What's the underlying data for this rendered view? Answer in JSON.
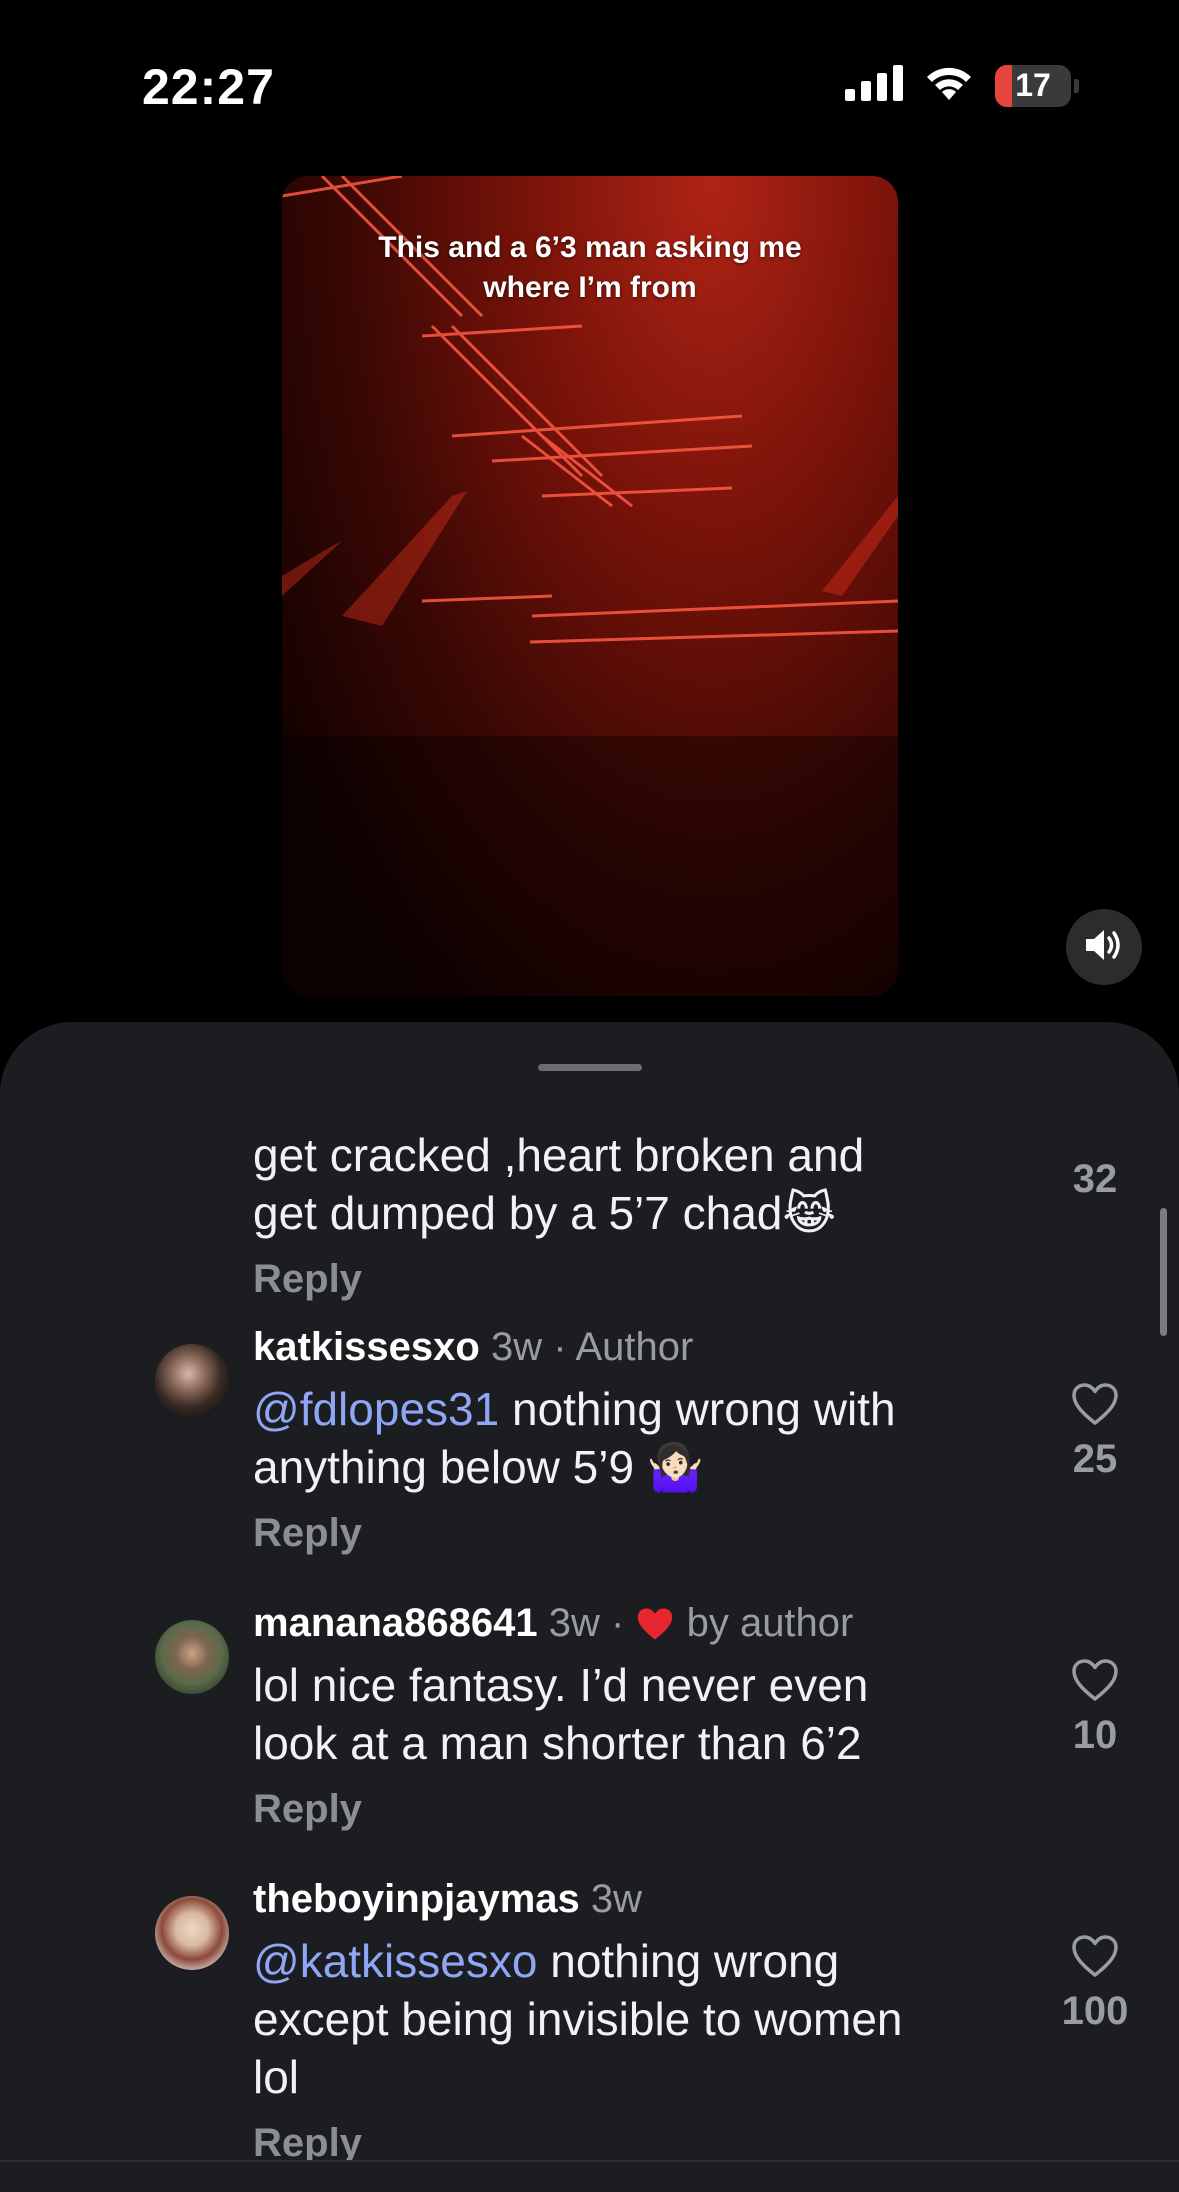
{
  "status_bar": {
    "time": "22:27",
    "battery_level": "17",
    "icons": [
      "signal-icon",
      "wifi-icon",
      "battery-icon"
    ]
  },
  "video": {
    "caption_line1": "This and a 6’3 man asking me",
    "caption_line2": "where I’m from",
    "mute_icon": "speaker-muted-icon"
  },
  "comments": [
    {
      "body_line1": "get cracked ,heart broken and",
      "body_line2": "get dumped by a 5’7 chad",
      "emoji": "😹",
      "reply": "Reply",
      "likes": "32"
    },
    {
      "username": "katkissesxo",
      "time": "3w",
      "sep": " · ",
      "tag": "Author",
      "mention": "@fdlopes31",
      "body_rest": " nothing wrong with",
      "body_line2": "anything below 5’9 ",
      "emoji": "🤷🏻‍♀️",
      "reply": "Reply",
      "likes": "25"
    },
    {
      "username": "manana868641",
      "time": "3w",
      "sep": " · ",
      "tag": " by author",
      "body_line1": "lol nice fantasy. I’d never even",
      "body_line2": "look at a man shorter than 6’2",
      "reply": "Reply",
      "likes": "10"
    },
    {
      "username": "theboyinpjaymas",
      "time": "3w",
      "mention": "@katkissesxo",
      "body_rest": " nothing wrong",
      "body_line2": "except being invisible to women",
      "body_line3": "lol",
      "reply": "Reply",
      "likes": "100"
    }
  ],
  "colors": {
    "sheet_bg": "#1c1d21",
    "mention": "#8ea6f3",
    "heart_red": "#e8262f",
    "battery_low": "#e5443f"
  }
}
